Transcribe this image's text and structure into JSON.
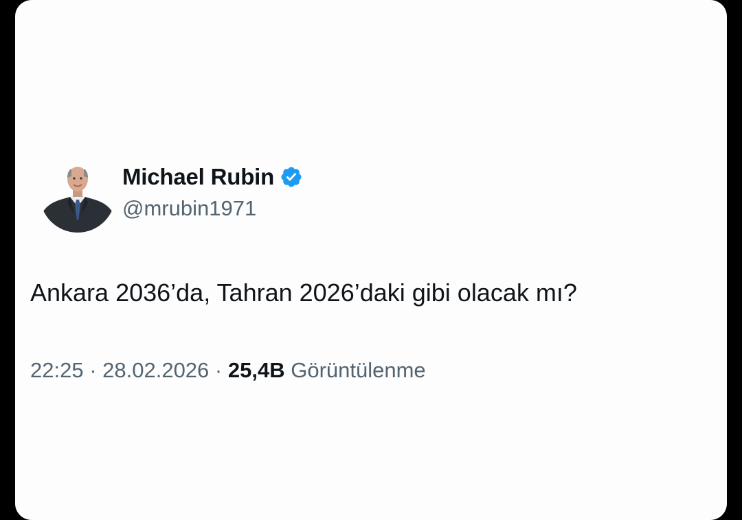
{
  "tweet": {
    "author": {
      "name": "Michael Rubin",
      "handle": "@mrubin1971",
      "verified": true
    },
    "text": "Ankara 2036’da, Tahran 2026’daki gibi olacak mı?",
    "meta": {
      "time": "22:25",
      "separator": " · ",
      "date": "28.02.2026",
      "views_count": "25,4B",
      "views_label": "Görüntülenme"
    }
  },
  "icons": {
    "verified": "verified-badge-icon",
    "avatar": "profile-photo"
  },
  "colors": {
    "background": "#000000",
    "card": "#fdfdfd",
    "text_primary": "#0f1419",
    "text_secondary": "#536471",
    "verified_blue": "#1d9bf0"
  }
}
